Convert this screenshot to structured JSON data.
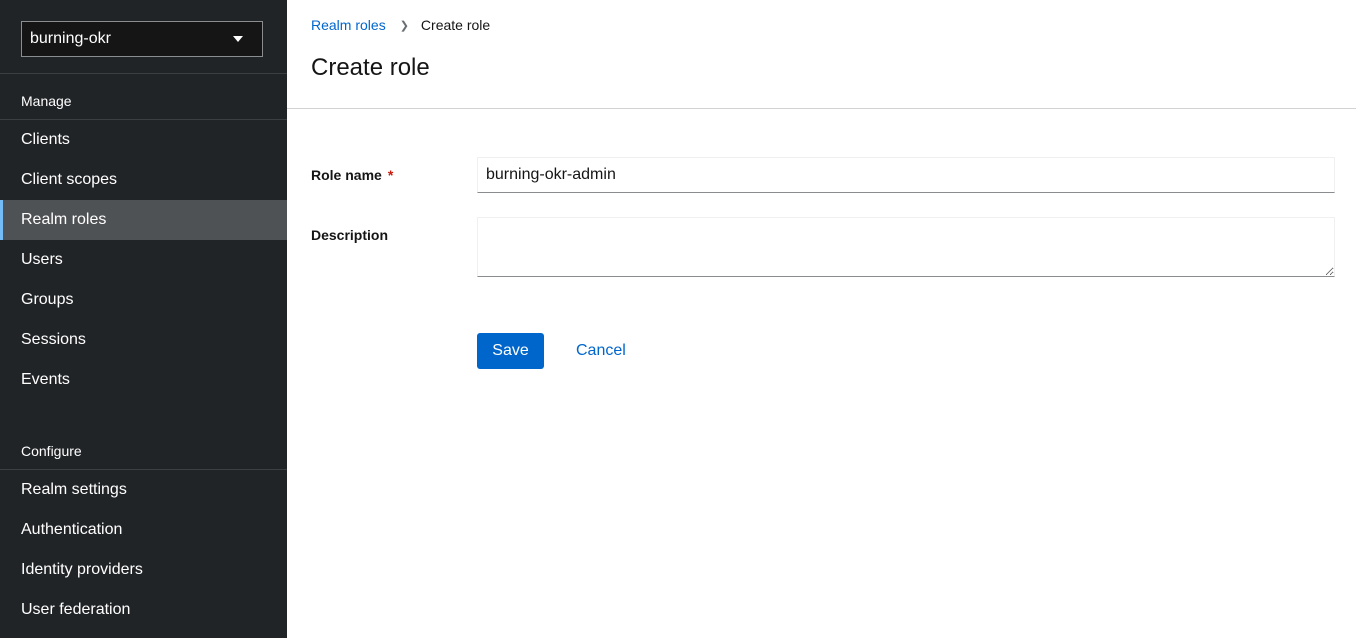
{
  "sidebar": {
    "realm_selector": {
      "value": "burning-okr",
      "icon": "caret-down-icon"
    },
    "manage_title": "Manage",
    "manage_items": [
      {
        "label": "Clients"
      },
      {
        "label": "Client scopes"
      },
      {
        "label": "Realm roles",
        "active": true
      },
      {
        "label": "Users"
      },
      {
        "label": "Groups"
      },
      {
        "label": "Sessions"
      },
      {
        "label": "Events"
      }
    ],
    "configure_title": "Configure",
    "configure_items": [
      {
        "label": "Realm settings"
      },
      {
        "label": "Authentication"
      },
      {
        "label": "Identity providers"
      },
      {
        "label": "User federation"
      }
    ]
  },
  "breadcrumb": {
    "parent": "Realm roles",
    "current": "Create role"
  },
  "page_title": "Create role",
  "form": {
    "role_name_label": "Role name",
    "required_marker": "*",
    "role_name_value": "burning-okr-admin",
    "description_label": "Description",
    "description_value": "",
    "save_label": "Save",
    "cancel_label": "Cancel"
  },
  "colors": {
    "sidebar_bg": "#212427",
    "active_item_bg": "#4f5255",
    "primary": "#0066cc",
    "required": "#c9190b"
  }
}
